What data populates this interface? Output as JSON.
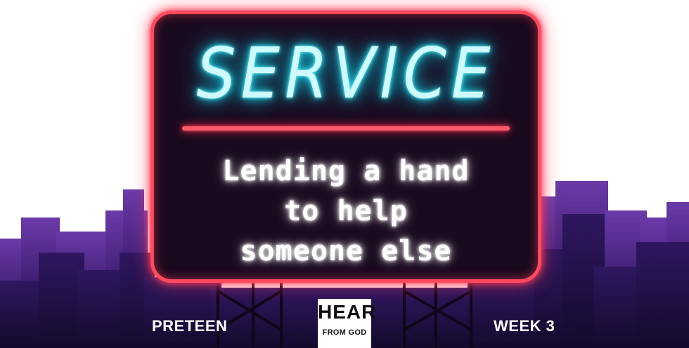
{
  "sign": {
    "title": "SERVICE",
    "tagline": [
      "Lending a hand",
      "to help",
      "someone else"
    ]
  },
  "footer": {
    "left_label": "PRETEEN",
    "right_label": "WEEK 3",
    "logo": {
      "top": "HEAR",
      "bottom": "FROM GOD"
    }
  },
  "colors": {
    "background": "#ffffff",
    "skyline_dark": "#1c0f3a",
    "skyline_light": "#6b3aa8",
    "sign_fill": "#1a0a1e",
    "neon_red": "#ff4a5e",
    "neon_cyan": "#2fe3f5",
    "neon_white": "#ffffff"
  }
}
